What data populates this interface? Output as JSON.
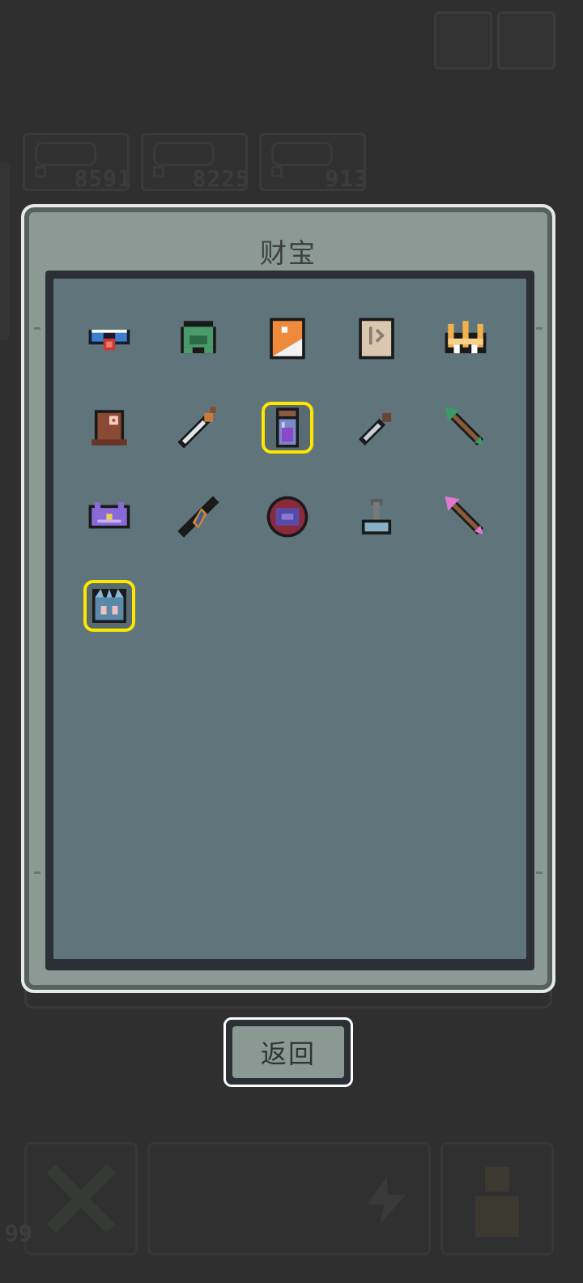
{
  "background": {
    "resources": [
      {
        "name": "resource-1",
        "value": "8591"
      },
      {
        "name": "resource-2",
        "value": "8225"
      },
      {
        "name": "resource-3",
        "value": "913"
      }
    ],
    "level": "99"
  },
  "dialog": {
    "title": "财宝",
    "items": [
      {
        "icon": "goggles-icon",
        "highlight": false
      },
      {
        "icon": "green-helmet-icon",
        "highlight": false
      },
      {
        "icon": "orange-flag-icon",
        "highlight": false
      },
      {
        "icon": "parchment-map-icon",
        "highlight": false
      },
      {
        "icon": "golden-crown-icon",
        "highlight": false
      },
      {
        "icon": "wooden-totem-icon",
        "highlight": false
      },
      {
        "icon": "sword-icon",
        "highlight": false
      },
      {
        "icon": "purple-potion-jar-icon",
        "highlight": true
      },
      {
        "icon": "dagger-icon",
        "highlight": false
      },
      {
        "icon": "green-arrow-icon",
        "highlight": false
      },
      {
        "icon": "purple-bat-crown-icon",
        "highlight": false
      },
      {
        "icon": "gem-wand-icon",
        "highlight": false
      },
      {
        "icon": "dark-orb-icon",
        "highlight": false
      },
      {
        "icon": "anvil-lever-icon",
        "highlight": false
      },
      {
        "icon": "pink-arrow-icon",
        "highlight": false
      },
      {
        "icon": "ice-crown-icon",
        "highlight": true
      }
    ]
  },
  "back_button": {
    "label": "返回"
  },
  "colors": {
    "highlight": "#ffe600",
    "panel": "#5f757b",
    "dialog": "#8b9a94"
  }
}
